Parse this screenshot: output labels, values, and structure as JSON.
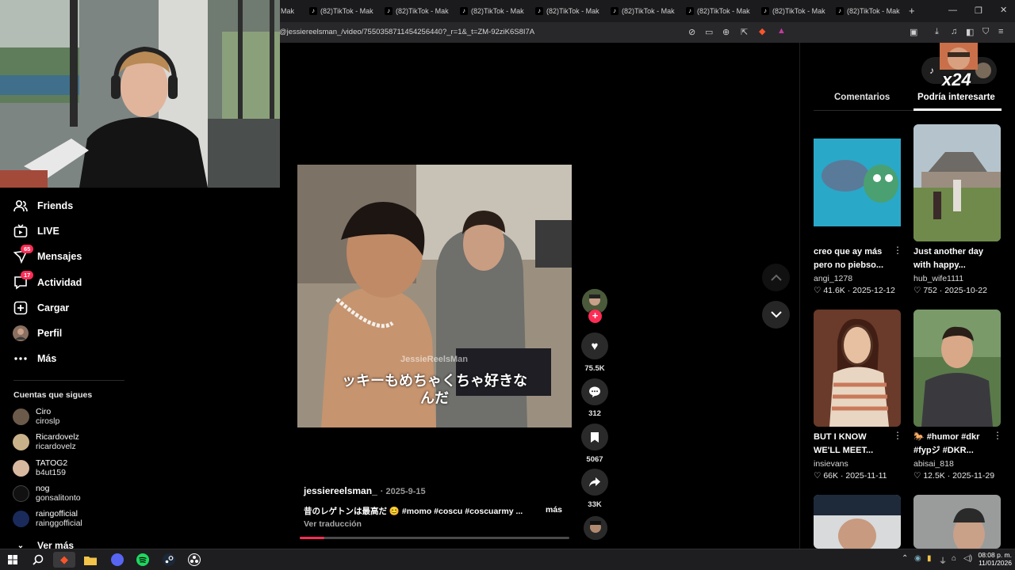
{
  "browser": {
    "tabs": [
      {
        "label": "Mak",
        "favicon": "tiktok-icon"
      },
      {
        "label": "(82)TikTok - Mak",
        "favicon": "tiktok-icon"
      },
      {
        "label": "(82)TikTok - Mak",
        "favicon": "tiktok-icon"
      },
      {
        "label": "(82)TikTok - Mak",
        "favicon": "tiktok-icon"
      },
      {
        "label": "(82)TikTok - Mak",
        "favicon": "tiktok-icon"
      },
      {
        "label": "(82)TikTok - Mak",
        "favicon": "tiktok-icon"
      },
      {
        "label": "(82)TikTok - Mak",
        "favicon": "tiktok-icon"
      },
      {
        "label": "(82)TikTok - Mak",
        "favicon": "tiktok-icon"
      },
      {
        "label": "(82)TikTok - Mak",
        "favicon": "tiktok-icon"
      }
    ],
    "new_tab_label": "+",
    "url": "@jessiereelsman_/video/7550358711454256440?_r=1&_t=ZM-92ziK6S8I7A"
  },
  "sidebar": {
    "nav": [
      {
        "label": "Friends",
        "icon": "friends-icon"
      },
      {
        "label": "LIVE",
        "icon": "live-icon"
      },
      {
        "label": "Mensajes",
        "icon": "messages-icon",
        "badge": "65"
      },
      {
        "label": "Actividad",
        "icon": "activity-icon",
        "badge": "17"
      },
      {
        "label": "Cargar",
        "icon": "upload-icon"
      },
      {
        "label": "Perfil",
        "icon": "profile-avatar"
      },
      {
        "label": "Más",
        "icon": "more-icon"
      }
    ],
    "following_title": "Cuentas que sigues",
    "following": [
      {
        "name": "Ciro",
        "username": "ciroslp"
      },
      {
        "name": "Ricardovelz",
        "username": "ricardovelz"
      },
      {
        "name": "TATOG2",
        "username": "b4ut159"
      },
      {
        "name": "nog",
        "username": "gonsalitonto"
      },
      {
        "name": "raingofficial",
        "username": "rainggofficial"
      }
    ],
    "see_more": "Ver más"
  },
  "video": {
    "subtitle_line1": "ッキーもめちゃくちゃ好きな",
    "subtitle_line2": "んだ",
    "watermark": "JessieReelsMan",
    "author": "jessiereelsman_",
    "date": "· 2025-9-15",
    "caption": "昔のレゲトンは最高だ 😊 #momo #coscu #coscuarmy ...",
    "more": "más",
    "translate": "Ver traducción",
    "progress": 0.09
  },
  "actions": {
    "likes": "75.5K",
    "comments": "312",
    "saves": "5067",
    "shares": "33K"
  },
  "overlay_badge": "x24",
  "panel": {
    "tab_comments": "Comentarios",
    "tab_interest": "Podría interesarte",
    "cards": [
      {
        "title_l1": "creo que ay más",
        "title_l2": "pero no piebso...",
        "user": "angi_1278",
        "likes": "41.6K",
        "date": "2025-12-12"
      },
      {
        "title_l1": "Just another day",
        "title_l2": "with happy...",
        "user": "hub_wife1111",
        "likes": "752",
        "date": "2025-10-22"
      },
      {
        "title_l1": "BUT I KNOW",
        "title_l2": "WE'LL MEET...",
        "user": "insievans",
        "likes": "66K",
        "date": "2025-11-11"
      },
      {
        "title_l1": "🐎 #humor #dkr",
        "title_l2": "#fypジ #DKR...",
        "user": "abisai_818",
        "likes": "12.5K",
        "date": "2025-11-29"
      }
    ]
  },
  "taskbar": {
    "time": "08:08 p. m.",
    "date": "11/01/2026"
  },
  "colors": {
    "accent": "#fe2c55",
    "background": "#000000"
  }
}
